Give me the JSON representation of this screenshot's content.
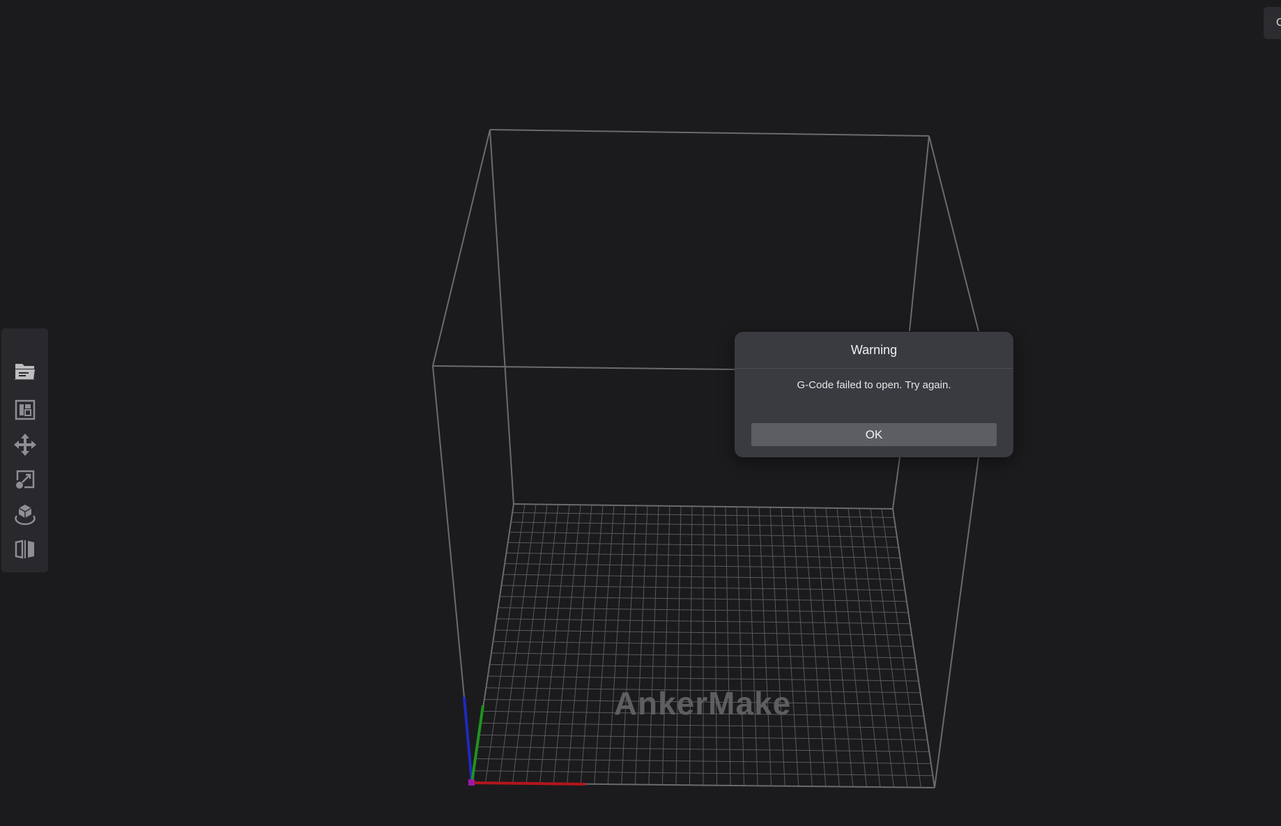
{
  "app": {
    "bed_logo_text": "AnkerMake",
    "top_right_button_label": "C"
  },
  "toolbar": {
    "items": [
      {
        "name": "open-file",
        "icon": "folder-open-icon"
      },
      {
        "name": "layout",
        "icon": "layout-panel-icon"
      },
      {
        "name": "move",
        "icon": "move-arrows-icon"
      },
      {
        "name": "scale",
        "icon": "scale-icon"
      },
      {
        "name": "rotate",
        "icon": "rotate-cube-icon"
      },
      {
        "name": "mirror",
        "icon": "mirror-icon"
      }
    ]
  },
  "dialog": {
    "title": "Warning",
    "message": "G-Code failed to open. Try again.",
    "ok_label": "OK"
  },
  "colors": {
    "background": "#1b1b1d",
    "toolbar_bg": "#29292d",
    "dialog_bg": "#3a3b40",
    "button_bg": "#5d5e63",
    "axis_x": "#c0141e",
    "axis_y": "#1e9a1e",
    "axis_z": "#1e28c8"
  }
}
